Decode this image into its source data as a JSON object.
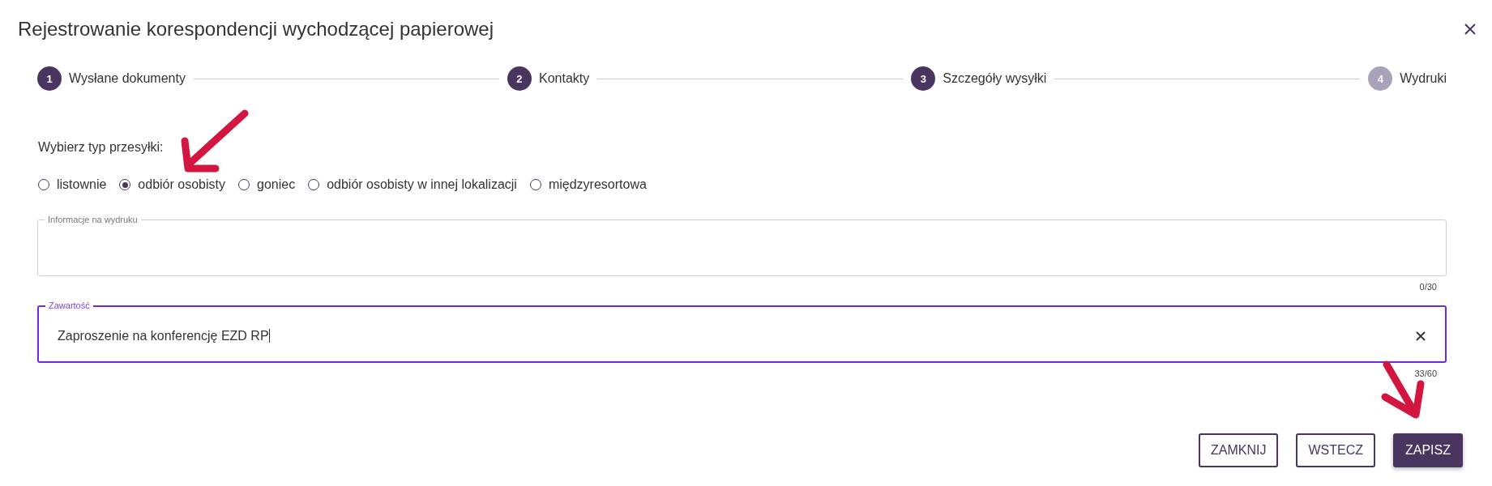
{
  "dialog": {
    "title": "Rejestrowanie korespondencji wychodzącej papierowej"
  },
  "steps": [
    {
      "number": "1",
      "label": "Wysłane dokumenty",
      "disabled": false
    },
    {
      "number": "2",
      "label": "Kontakty",
      "disabled": false
    },
    {
      "number": "3",
      "label": "Szczegóły wysyłki",
      "disabled": false
    },
    {
      "number": "4",
      "label": "Wydruki",
      "disabled": true
    }
  ],
  "shipment_type": {
    "label": "Wybierz typ przesyłki:",
    "options": [
      {
        "label": "listownie",
        "selected": false
      },
      {
        "label": "odbiór osobisty",
        "selected": true
      },
      {
        "label": "goniec",
        "selected": false
      },
      {
        "label": "odbiór osobisty w innej lokalizacji",
        "selected": false
      },
      {
        "label": "międzyresortowa",
        "selected": false
      }
    ]
  },
  "fields": [
    {
      "label": "Informacje na wydruku",
      "counter": "0/30",
      "focused": false
    },
    {
      "label": "Zawartość",
      "value": "Zaproszenie na konferencję EZD RP",
      "counter": "33/60",
      "focused": true
    }
  ],
  "buttons": [
    {
      "label": "ZAMKNIJ",
      "kind": "outlined"
    },
    {
      "label": "WSTECZ",
      "kind": "outlined"
    },
    {
      "label": "ZAPISZ",
      "kind": "primary"
    }
  ]
}
